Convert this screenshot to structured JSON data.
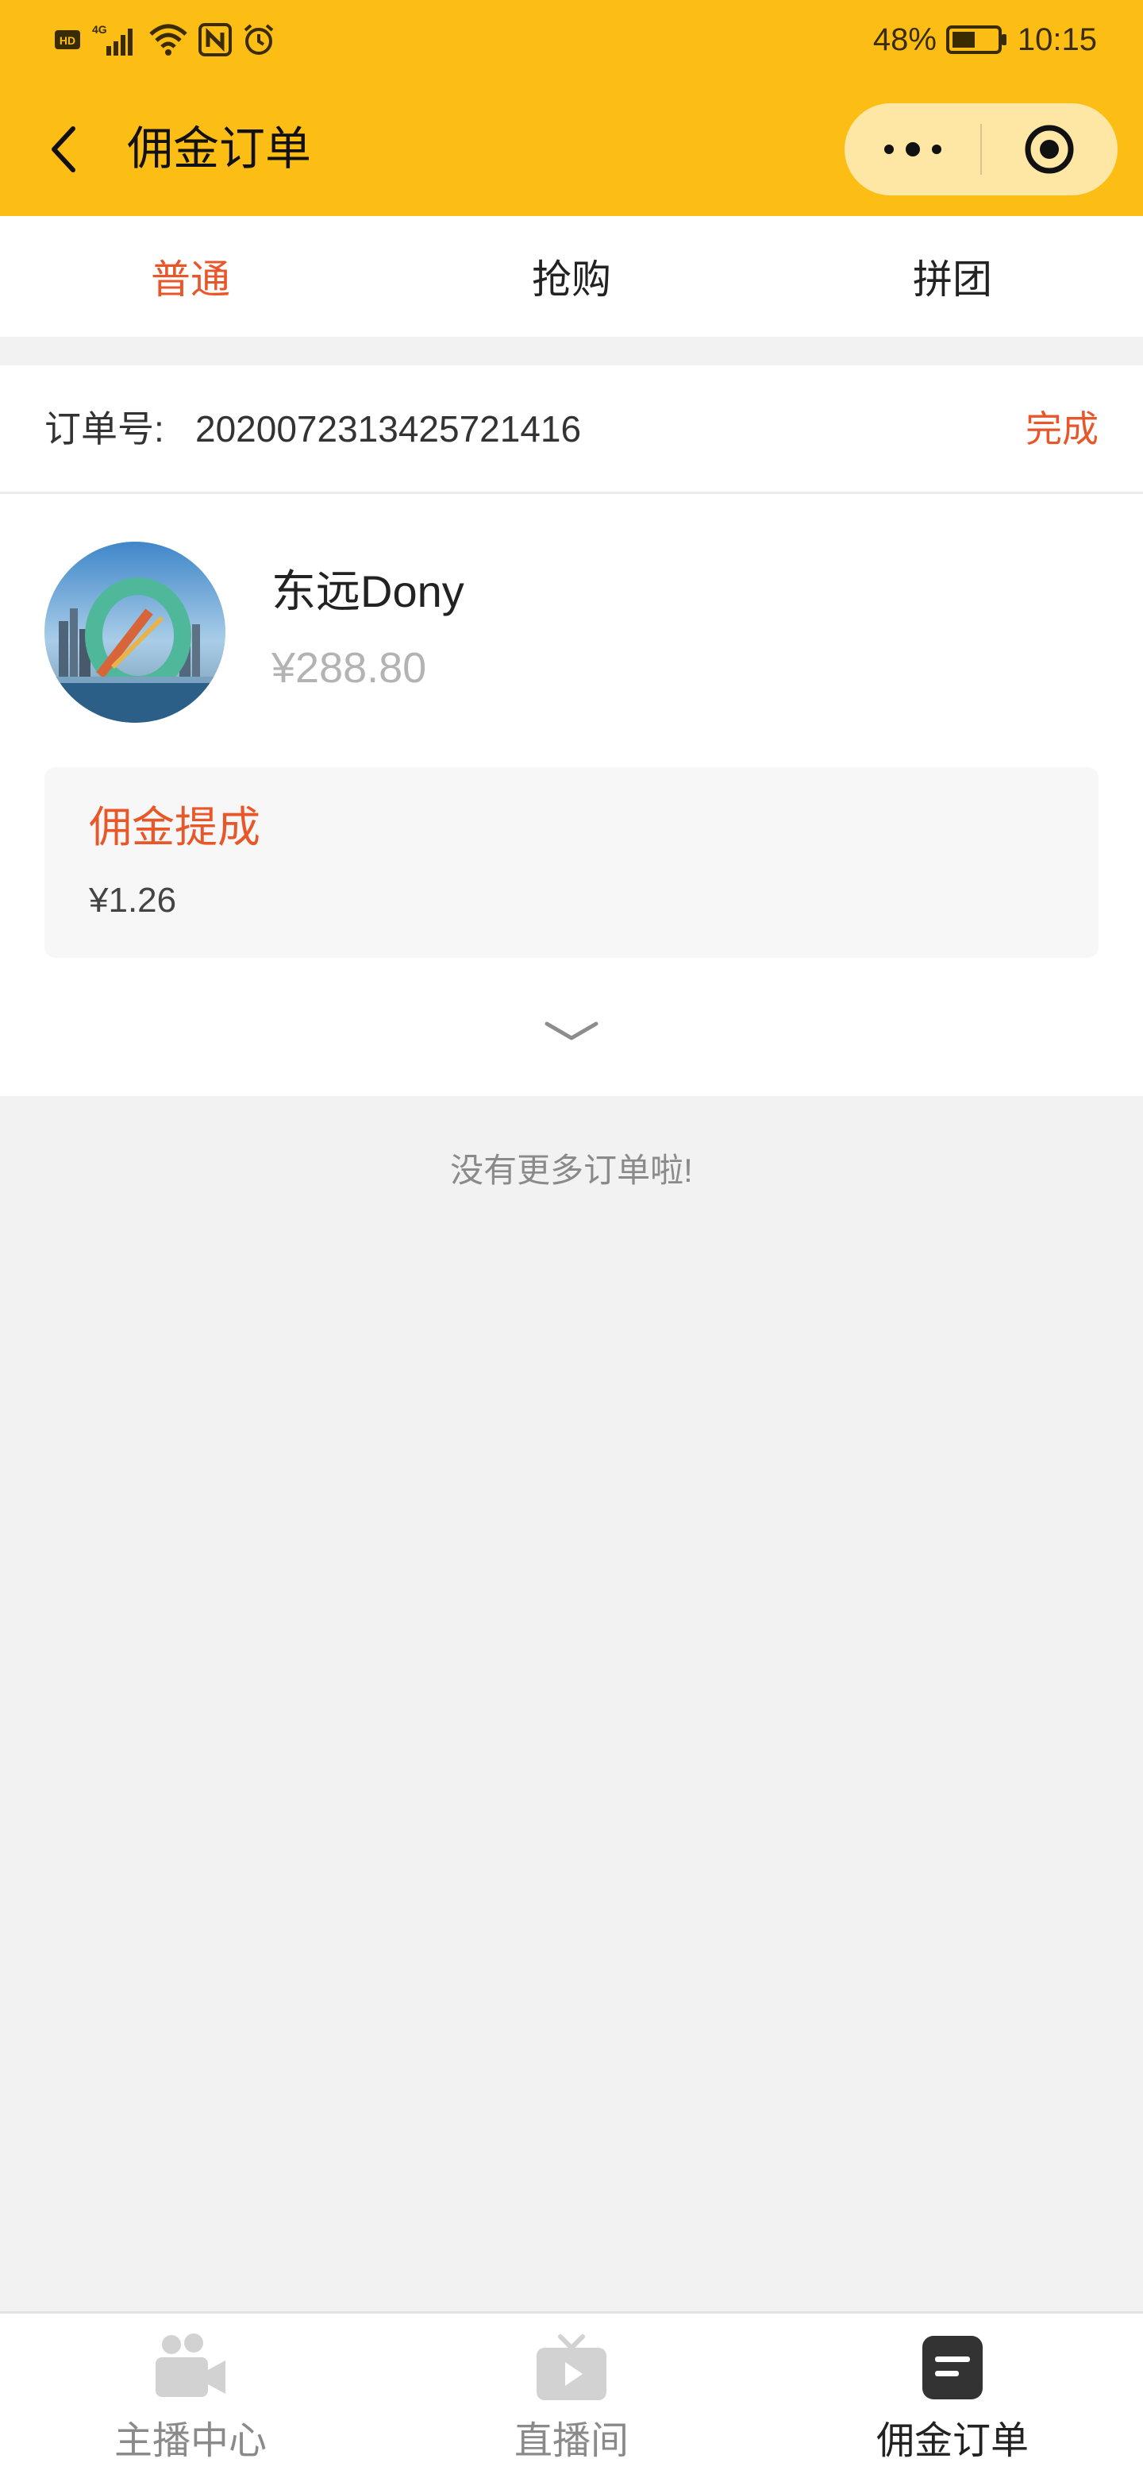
{
  "status_bar": {
    "network": "4G",
    "hd": "HD",
    "battery": "48%",
    "time": "10:15",
    "icons": [
      "hd-icon",
      "signal-icon",
      "wifi-icon",
      "nfc-icon",
      "alarm-icon",
      "battery-icon"
    ]
  },
  "nav": {
    "title": "佣金订单",
    "back_icon": "back-arrow-icon",
    "more_icon": "more-dots-icon",
    "close_icon": "target-close-icon"
  },
  "tabs": [
    {
      "label": "普通",
      "active": true
    },
    {
      "label": "抢购",
      "active": false
    },
    {
      "label": "拼团",
      "active": false
    }
  ],
  "order": {
    "number_label": "订单号:",
    "number": "2020072313425721416",
    "status": "完成",
    "user_name": "东远Dony",
    "amount": "¥288.80",
    "commission_title": "佣金提成",
    "commission_value": "¥1.26"
  },
  "list_end_text": "没有更多订单啦!",
  "tabbar": [
    {
      "label": "主播中心",
      "icon": "video-camera-icon",
      "active": false
    },
    {
      "label": "直播间",
      "icon": "tv-play-icon",
      "active": false
    },
    {
      "label": "佣金订单",
      "icon": "order-list-icon",
      "active": true
    }
  ],
  "colors": {
    "header_bg": "#fcbd14",
    "accent": "#e8572a",
    "page_bg": "#f2f2f2"
  }
}
